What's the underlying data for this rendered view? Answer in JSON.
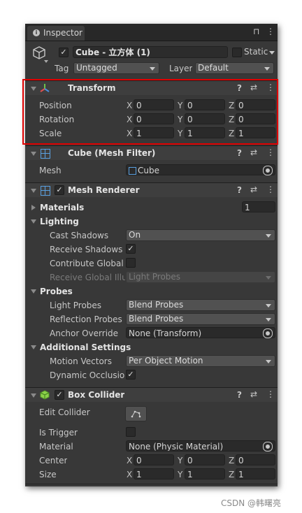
{
  "window": {
    "tab_title": "Inspector"
  },
  "gameobject": {
    "name": "Cube - 立方体 (1)",
    "static_label": "Static",
    "tag_label": "Tag",
    "tag_value": "Untagged",
    "layer_label": "Layer",
    "layer_value": "Default"
  },
  "transform": {
    "title": "Transform",
    "position_label": "Position",
    "rotation_label": "Rotation",
    "scale_label": "Scale",
    "axes": [
      "X",
      "Y",
      "Z"
    ],
    "position": [
      "0",
      "0",
      "0"
    ],
    "rotation": [
      "0",
      "0",
      "0"
    ],
    "scale": [
      "1",
      "1",
      "1"
    ]
  },
  "mesh_filter": {
    "title": "Cube (Mesh Filter)",
    "mesh_label": "Mesh",
    "mesh_value": "Cube"
  },
  "mesh_renderer": {
    "title": "Mesh Renderer",
    "materials_label": "Materials",
    "materials_count": "1",
    "lighting_label": "Lighting",
    "cast_shadows_label": "Cast Shadows",
    "cast_shadows_value": "On",
    "receive_shadows_label": "Receive Shadows",
    "contribute_gi_label": "Contribute Global Il",
    "receive_gi_label": "Receive Global Illur",
    "receive_gi_value": "Light Probes",
    "probes_label": "Probes",
    "light_probes_label": "Light Probes",
    "light_probes_value": "Blend Probes",
    "reflection_probes_label": "Reflection Probes",
    "reflection_probes_value": "Blend Probes",
    "anchor_override_label": "Anchor Override",
    "anchor_override_value": "None (Transform)",
    "additional_label": "Additional Settings",
    "motion_vectors_label": "Motion Vectors",
    "motion_vectors_value": "Per Object Motion",
    "dynamic_occlusion_label": "Dynamic Occlusion"
  },
  "box_collider": {
    "title": "Box Collider",
    "edit_label": "Edit Collider",
    "trigger_label": "Is Trigger",
    "material_label": "Material",
    "material_value": "None (Physic Material)",
    "center_label": "Center",
    "size_label": "Size",
    "center": [
      "0",
      "0",
      "0"
    ],
    "size": [
      "1",
      "1",
      "1"
    ]
  },
  "watermark": "CSDN @韩曙亮",
  "colors": {
    "highlight": "#e00000",
    "panel": "#383838",
    "header": "#3e3e3e"
  }
}
